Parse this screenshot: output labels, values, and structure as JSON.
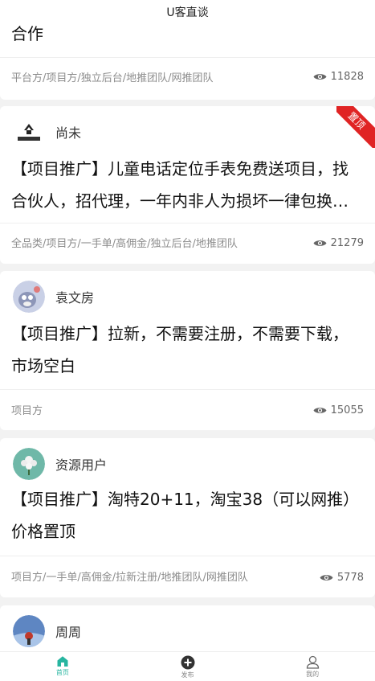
{
  "header": {
    "title": "U客直谈"
  },
  "cards": [
    {
      "author": "",
      "title": "合作",
      "tags": "平台方/项目方/独立后台/地推团队/网推团队",
      "views": "11828",
      "badge": ""
    },
    {
      "author": "尚未",
      "title": "【项目推广】儿童电话定位手表免费送项目，找合伙人，招代理，一年内非人为损坏一律包换…",
      "tags": "全品类/项目方/一手单/高佣金/独立后台/地推团队",
      "views": "21279",
      "badge": "置顶"
    },
    {
      "author": "袁文房",
      "title": "【项目推广】拉新，不需要注册，不需要下载，市场空白",
      "tags": "项目方",
      "views": "15055",
      "badge": ""
    },
    {
      "author": "资源用户",
      "title": "【项目推广】淘特20+11，淘宝38（可以网推）价格置顶",
      "tags": "项目方/一手单/高佣金/拉新注册/地推团队/网推团队",
      "views": "5778",
      "badge": ""
    },
    {
      "author": "周周",
      "title": "",
      "tags": "",
      "views": "",
      "badge": ""
    }
  ],
  "tabbar": {
    "items": [
      {
        "label": "首页",
        "icon": "home-icon",
        "active": true
      },
      {
        "label": "发布",
        "icon": "plus-circle-icon",
        "active": false
      },
      {
        "label": "我的",
        "icon": "user-icon",
        "active": false
      }
    ]
  },
  "colors": {
    "accent": "#27b5a0",
    "badge": "#e02424",
    "background": "#f2f2f2"
  }
}
